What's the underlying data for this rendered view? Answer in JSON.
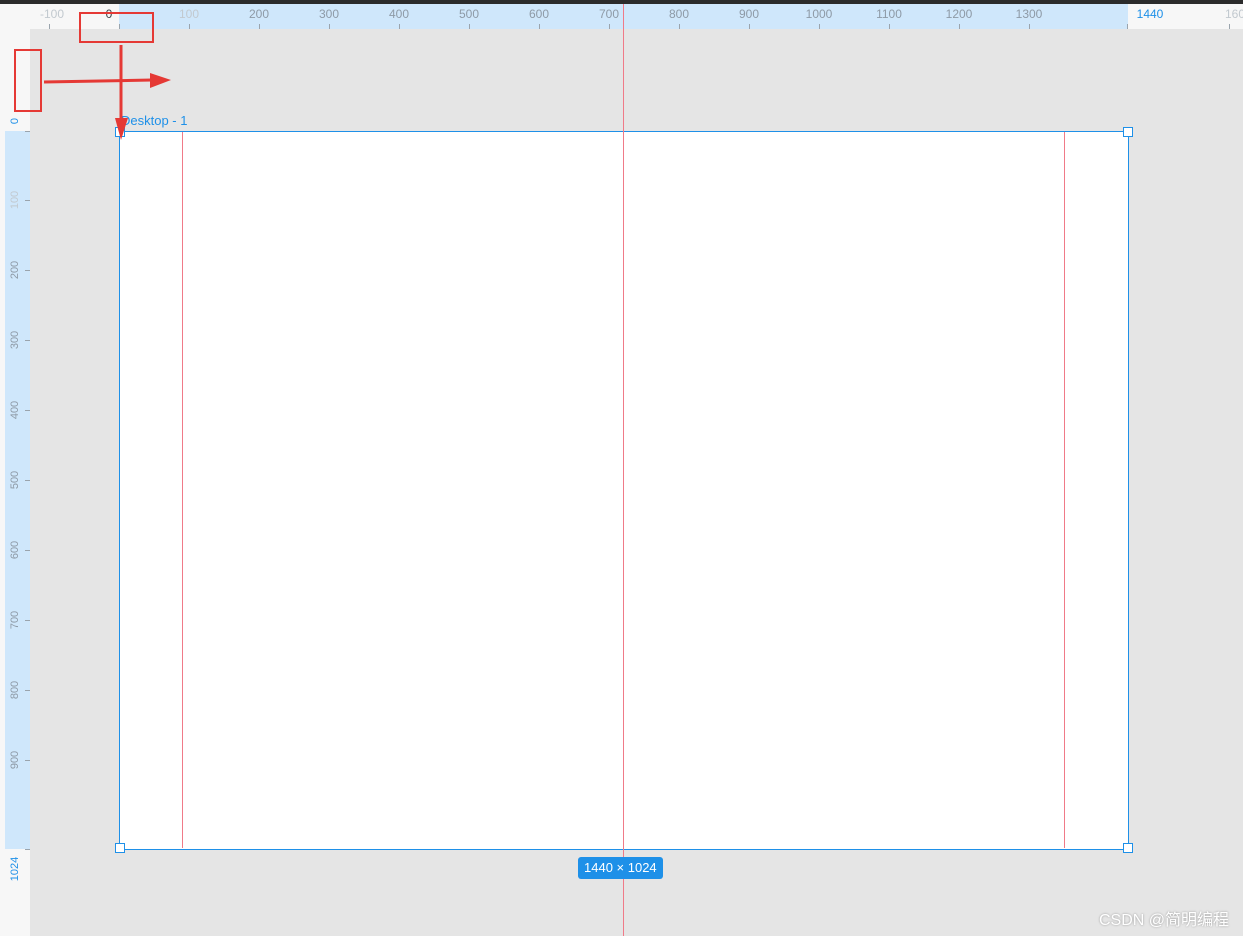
{
  "ruler_h": {
    "labels": [
      "-100",
      "0",
      "100",
      "200",
      "300",
      "400",
      "500",
      "600",
      "700",
      "800",
      "900",
      "1000",
      "1100",
      "1200",
      "1300",
      "1440",
      "160"
    ]
  },
  "ruler_v": {
    "labels": [
      "0",
      "100",
      "200",
      "300",
      "400",
      "500",
      "600",
      "700",
      "800",
      "900",
      "1024"
    ]
  },
  "frame": {
    "name": "Desktop - 1",
    "size": "1440 × 1024"
  },
  "colors": {
    "selection": "#1e90e8",
    "guide": "#f07a88",
    "annotation": "#e53935"
  },
  "watermark": "CSDN @简明编程"
}
